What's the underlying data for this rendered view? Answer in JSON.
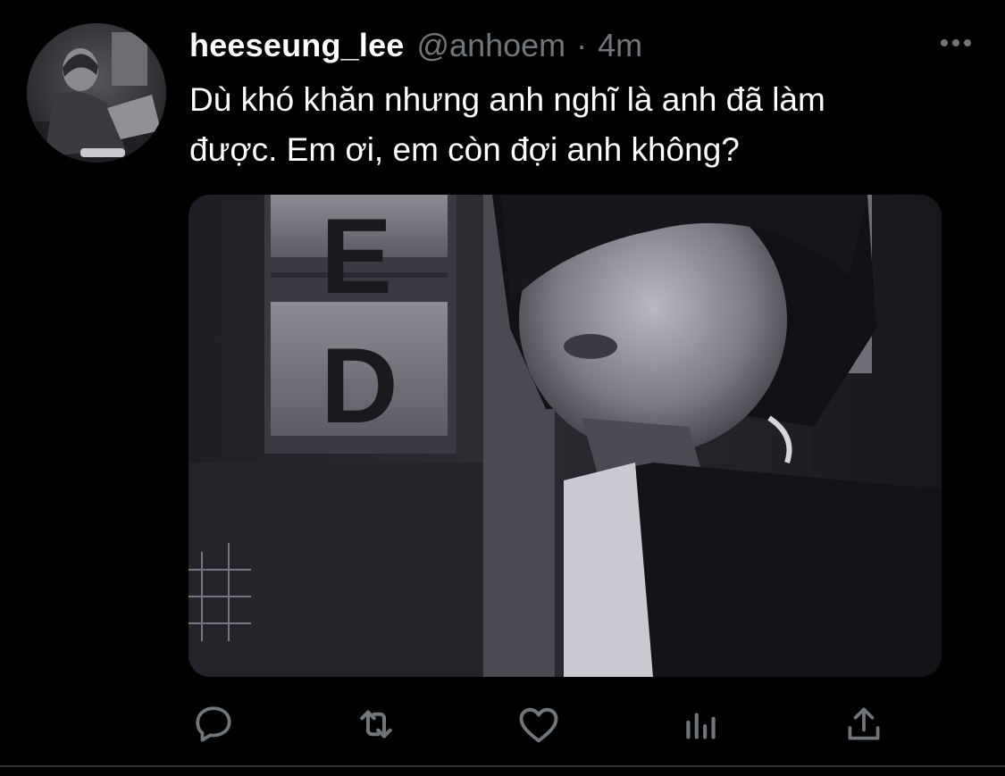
{
  "tweet": {
    "display_name": "heeseung_lee",
    "handle": "@anhoem",
    "separator": "·",
    "time": "4m",
    "text_line1": "Dù khó khăn nhưng anh nghĩ là anh đã làm",
    "text_line2": "được. Em ơi, em còn đợi anh không?"
  },
  "media": {
    "sign_letters": [
      "E",
      "D"
    ]
  },
  "icons": {
    "more": "more-horizontal-icon",
    "reply": "reply-icon",
    "retweet": "retweet-icon",
    "like": "heart-icon",
    "analytics": "analytics-icon",
    "share": "share-icon"
  },
  "colors": {
    "background": "#000000",
    "text_primary": "#ffffff",
    "text_secondary": "#71767b",
    "divider": "#2f3336"
  }
}
